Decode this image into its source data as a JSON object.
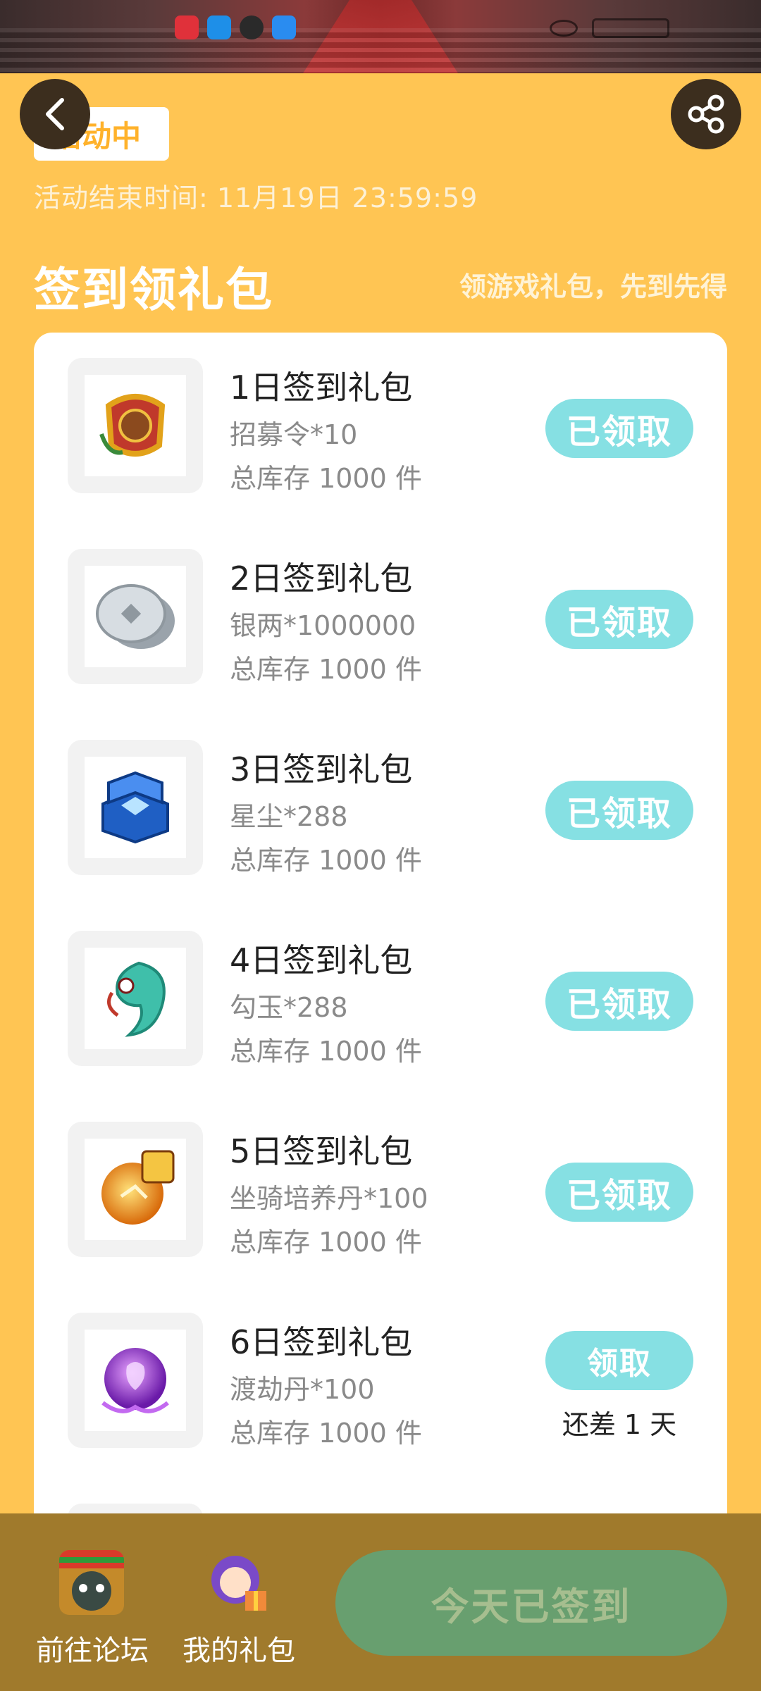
{
  "header": {
    "status_tag": "活动中",
    "end_time_label": "活动结束时间:",
    "end_time_value": "11月19日 23:59:59"
  },
  "section": {
    "title": "签到领礼包",
    "subtitle": "领游戏礼包，先到先得"
  },
  "gifts": [
    {
      "name": "1日签到礼包",
      "reward": "招募令*10",
      "stock": "总库存 1000 件",
      "button": "已领取",
      "icon": "recruit-token-icon"
    },
    {
      "name": "2日签到礼包",
      "reward": "银两*1000000",
      "stock": "总库存 1000 件",
      "button": "已领取",
      "icon": "silver-coin-icon"
    },
    {
      "name": "3日签到礼包",
      "reward": "星尘*288",
      "stock": "总库存 1000 件",
      "button": "已领取",
      "icon": "stardust-chest-icon"
    },
    {
      "name": "4日签到礼包",
      "reward": "勾玉*288",
      "stock": "总库存 1000 件",
      "button": "已领取",
      "icon": "magatama-icon"
    },
    {
      "name": "5日签到礼包",
      "reward": "坐骑培养丹*100",
      "stock": "总库存 1000 件",
      "button": "已领取",
      "icon": "mount-pill-icon"
    },
    {
      "name": "6日签到礼包",
      "reward": "渡劫丹*100",
      "stock": "总库存 1000 件",
      "button": "领取",
      "remain": "还差 1 天",
      "icon": "tribulation-pill-icon"
    }
  ],
  "bottom": {
    "forum_label": "前往论坛",
    "mygift_label": "我的礼包",
    "signed_label": "今天已签到"
  },
  "colors": {
    "background": "#ffc553",
    "claim_button": "#86e0e3",
    "bottom_bar": "#a07a2c",
    "signed_button": "#689f6f"
  }
}
